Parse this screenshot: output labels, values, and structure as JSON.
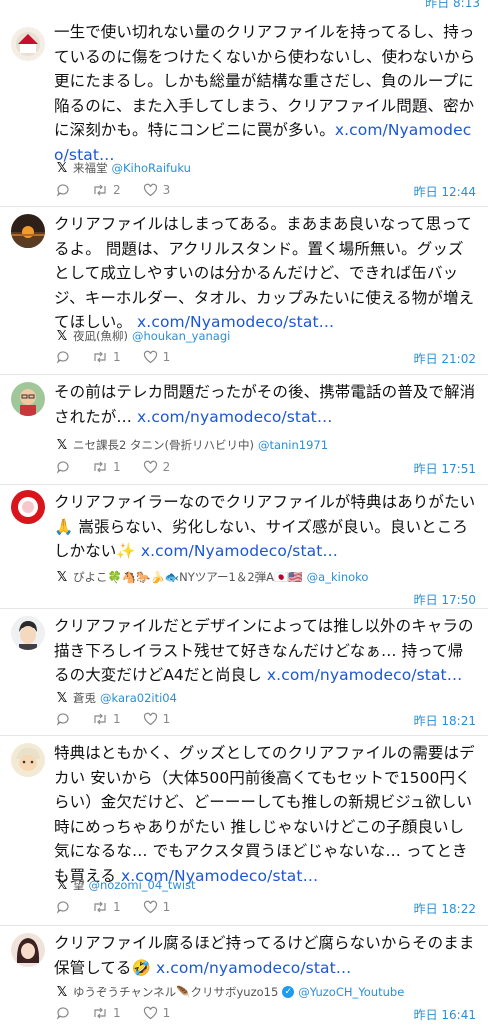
{
  "top_time_partial": "昨日 8:13",
  "posts": [
    {
      "text": "一生で使い切れない量のクリアファイルを持ってるし、持っているのに傷をつけたくないから使わないし、使わないから更にたまるし。しかも総量が結構な重さだし、負のループに陥るのに、また入手してしまう、クリアファイル問題、密かに深刻かも。特にコンビニに罠が多い。",
      "link": "x.com/Nyamodeco/stat…",
      "source_name": "来福堂",
      "handle": "@KihoRaifuku",
      "retweets": "2",
      "likes": "3",
      "time": "昨日 12:44"
    },
    {
      "text": "クリアファイルはしまってある。まあまあ良いなって思ってるよ。 問題は、アクリルスタンド。置く場所無い。グッズとして成立しやすいのは分かるんだけど、できれば缶バッジ、キーホルダー、タオル、カップみたいに使える物が増えてほしい。 ",
      "link": "x.com/Nyamodeco/stat…",
      "source_name": "夜凪(魚柳)",
      "handle": "@houkan_yanagi",
      "retweets": "1",
      "likes": "1",
      "time": "昨日 21:02"
    },
    {
      "text": "その前はテレカ問題だったがその後、携帯電話の普及で解消されたが… ",
      "link": "x.com/nyamodeco/stat…",
      "source_name": "ニセ課長2 タニン(骨折リハビリ中)",
      "handle": "@tanin1971",
      "retweets": "1",
      "likes": "2",
      "time": "昨日 17:51"
    },
    {
      "text": "クリアファイラーなのでクリアファイルが特典はありがたい🙏 嵩張らない、劣化しない、サイズ感が良い。良いところしかない✨ ",
      "link": "x.com/Nyamodeco/stat…",
      "source_name": "ぴよこ🍀🐴🐎🍌🐟NYツアー1＆2弾A🇯🇵🇺🇸",
      "handle": "@a_kinoko",
      "retweets": "",
      "likes": "",
      "time": "昨日 17:50"
    },
    {
      "text": "クリアファイルだとデザインによっては推し以外のキャラの描き下ろしイラスト残せて好きなんだけどなぁ… 持って帰るの大変だけどA4だと尚良し ",
      "link": "x.com/nyamodeco/stat…",
      "source_name": "蒼兎",
      "handle": "@kara02iti04",
      "retweets": "1",
      "likes": "1",
      "time": "昨日 18:21"
    },
    {
      "text": "特典はともかく、グッズとしてのクリアファイルの需要はデカい 安いから（大体500円前後高くてもセットで1500円くらい）金欠だけど、どーーーしても推しの新規ビジュ欲しい時にめっちゃありがたい 推しじゃないけどこの子顔良いし気になるな… でもアクスタ買うほどじゃないな… ってときも買える ",
      "link": "x.com/Nyamodeco/stat…",
      "source_name": "望",
      "handle": "@nozomi_04_twist",
      "retweets": "1",
      "likes": "1",
      "time": "昨日 18:22"
    },
    {
      "text": "クリアファイル腐るほど持ってるけど腐らないからそのまま保管してる🤣 ",
      "link": "x.com/nyamodeco/stat…",
      "source_name": "ゆうぞうチャンネル🪶クリサボyuzo15",
      "handle": "@YuzoCH_Youtube",
      "retweets": "1",
      "likes": "1",
      "time": "昨日 16:41"
    }
  ],
  "icons": {
    "reply": "reply-icon",
    "retweet": "retweet-icon",
    "like": "heart-icon",
    "source": "x-logo-icon",
    "verified": "verified-badge-icon"
  },
  "colors": {
    "link": "#1b57d6",
    "handle": "#2b8fd6",
    "time": "#2b8fd6",
    "divider": "#e4e6e8"
  }
}
